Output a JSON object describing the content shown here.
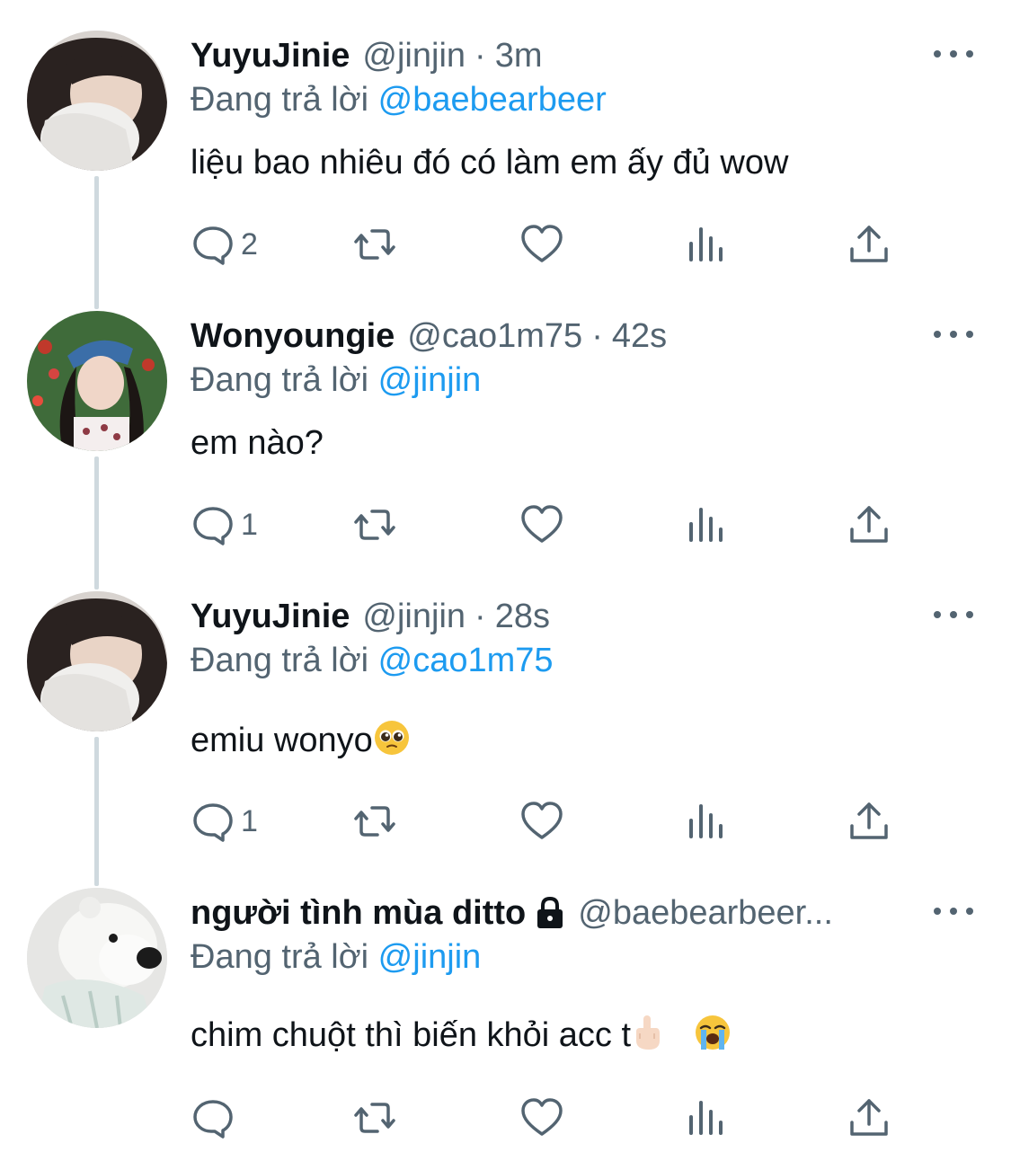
{
  "colors": {
    "accent": "#1d9bf0",
    "muted": "#536471",
    "text": "#0f1419",
    "thread_line": "#cfd9de"
  },
  "tweets": [
    {
      "name": "YuyuJinie",
      "handle": "@jinjin",
      "dot": "·",
      "time": "3m",
      "reply_prefix": "Đang trả lời ",
      "reply_to": "@baebearbeer",
      "text": "liệu bao nhiêu đó có làm em ấy đủ wow",
      "reply_count": "2"
    },
    {
      "name": "Wonyoungie",
      "handle": "@cao1m75",
      "dot": "·",
      "time": "42s",
      "reply_prefix": "Đang trả lời ",
      "reply_to": "@jinjin",
      "text": "em nào?",
      "reply_count": "1"
    },
    {
      "name": "YuyuJinie",
      "handle": "@jinjin",
      "dot": "·",
      "time": "28s",
      "reply_prefix": "Đang trả lời ",
      "reply_to": "@cao1m75",
      "text": "emiu wonyo",
      "reply_count": "1"
    },
    {
      "name": "người tình mùa ditto",
      "handle": "@baebearbeer...",
      "reply_prefix": "Đang trả lời ",
      "reply_to": "@jinjin",
      "text": "chim chuột thì biến khỏi acc t",
      "reply_count": ""
    }
  ],
  "icons": {
    "reply": "comment-bubble-icon",
    "retweet": "retweet-icon",
    "like": "heart-icon",
    "views": "analytics-bars-icon",
    "share": "share-upload-icon",
    "more": "more-dots-icon",
    "lock": "lock-icon"
  },
  "emojis": {
    "pleading": "pleading-face-emoji",
    "middle_finger": "middle-finger-emoji",
    "crying": "loudly-crying-face-emoji"
  }
}
